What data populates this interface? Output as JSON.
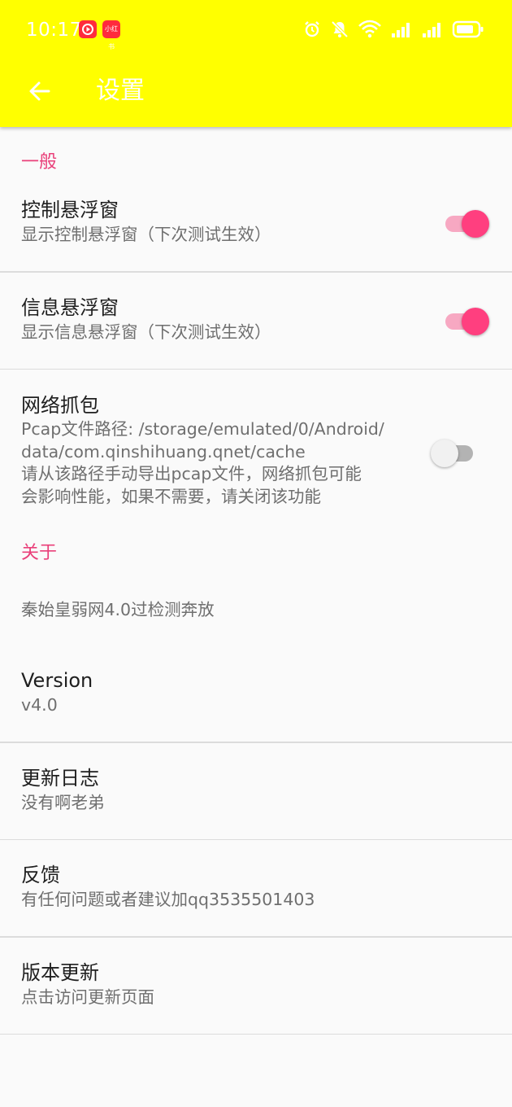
{
  "status_bar": {
    "time": "10:17",
    "badge_2_label": "小红书"
  },
  "toolbar": {
    "title": "设置"
  },
  "sections": {
    "general": {
      "header": "一般",
      "items": [
        {
          "title": "控制悬浮窗",
          "summary": "显示控制悬浮窗（下次测试生效）",
          "checked": true
        },
        {
          "title": "信息悬浮窗",
          "summary": "显示信息悬浮窗（下次测试生效）",
          "checked": true
        },
        {
          "title": "网络抓包",
          "summary_lines": [
            "Pcap文件路径: /storage/emulated/0/Android/",
            "data/com.qinshihuang.qnet/cache",
            "请从该路径手动导出pcap文件，网络抓包可能",
            "会影响性能，如果不需要，请关闭该功能"
          ],
          "checked": false
        }
      ]
    },
    "about": {
      "header": "关于",
      "description": "秦始皇弱网4.0过检测奔放",
      "items": [
        {
          "title": "Version",
          "summary": "v4.0"
        },
        {
          "title": "更新日志",
          "summary": "没有啊老弟"
        },
        {
          "title": "反馈",
          "summary": "有任何问题或者建议加qq3535501403"
        },
        {
          "title": "版本更新",
          "summary": "点击访问更新页面"
        }
      ]
    }
  },
  "colors": {
    "appbar": "#ffff00",
    "accent": "#e9407a",
    "switch_on": "#ff3f7f"
  }
}
